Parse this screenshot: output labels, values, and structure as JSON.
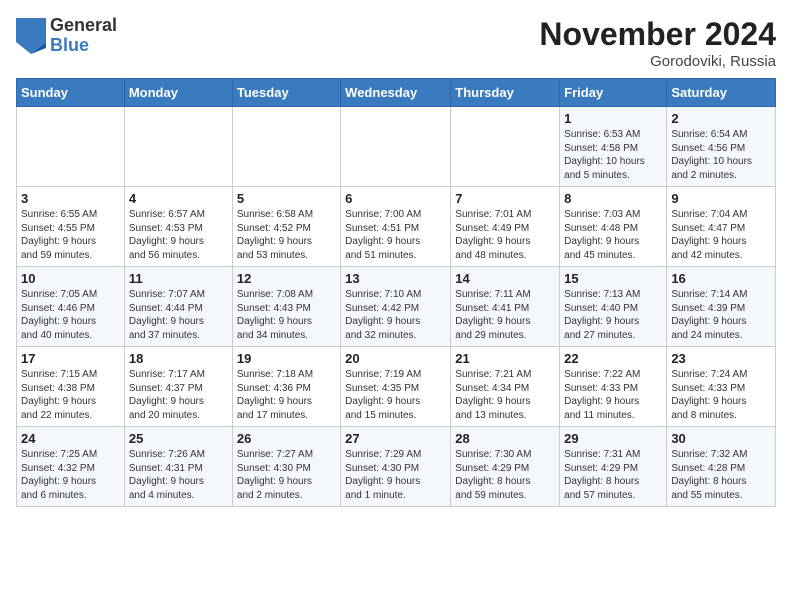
{
  "header": {
    "logo_general": "General",
    "logo_blue": "Blue",
    "month_title": "November 2024",
    "location": "Gorodoviki, Russia"
  },
  "columns": [
    "Sunday",
    "Monday",
    "Tuesday",
    "Wednesday",
    "Thursday",
    "Friday",
    "Saturday"
  ],
  "weeks": [
    [
      {
        "day": "",
        "info": ""
      },
      {
        "day": "",
        "info": ""
      },
      {
        "day": "",
        "info": ""
      },
      {
        "day": "",
        "info": ""
      },
      {
        "day": "",
        "info": ""
      },
      {
        "day": "1",
        "info": "Sunrise: 6:53 AM\nSunset: 4:58 PM\nDaylight: 10 hours\nand 5 minutes."
      },
      {
        "day": "2",
        "info": "Sunrise: 6:54 AM\nSunset: 4:56 PM\nDaylight: 10 hours\nand 2 minutes."
      }
    ],
    [
      {
        "day": "3",
        "info": "Sunrise: 6:55 AM\nSunset: 4:55 PM\nDaylight: 9 hours\nand 59 minutes."
      },
      {
        "day": "4",
        "info": "Sunrise: 6:57 AM\nSunset: 4:53 PM\nDaylight: 9 hours\nand 56 minutes."
      },
      {
        "day": "5",
        "info": "Sunrise: 6:58 AM\nSunset: 4:52 PM\nDaylight: 9 hours\nand 53 minutes."
      },
      {
        "day": "6",
        "info": "Sunrise: 7:00 AM\nSunset: 4:51 PM\nDaylight: 9 hours\nand 51 minutes."
      },
      {
        "day": "7",
        "info": "Sunrise: 7:01 AM\nSunset: 4:49 PM\nDaylight: 9 hours\nand 48 minutes."
      },
      {
        "day": "8",
        "info": "Sunrise: 7:03 AM\nSunset: 4:48 PM\nDaylight: 9 hours\nand 45 minutes."
      },
      {
        "day": "9",
        "info": "Sunrise: 7:04 AM\nSunset: 4:47 PM\nDaylight: 9 hours\nand 42 minutes."
      }
    ],
    [
      {
        "day": "10",
        "info": "Sunrise: 7:05 AM\nSunset: 4:46 PM\nDaylight: 9 hours\nand 40 minutes."
      },
      {
        "day": "11",
        "info": "Sunrise: 7:07 AM\nSunset: 4:44 PM\nDaylight: 9 hours\nand 37 minutes."
      },
      {
        "day": "12",
        "info": "Sunrise: 7:08 AM\nSunset: 4:43 PM\nDaylight: 9 hours\nand 34 minutes."
      },
      {
        "day": "13",
        "info": "Sunrise: 7:10 AM\nSunset: 4:42 PM\nDaylight: 9 hours\nand 32 minutes."
      },
      {
        "day": "14",
        "info": "Sunrise: 7:11 AM\nSunset: 4:41 PM\nDaylight: 9 hours\nand 29 minutes."
      },
      {
        "day": "15",
        "info": "Sunrise: 7:13 AM\nSunset: 4:40 PM\nDaylight: 9 hours\nand 27 minutes."
      },
      {
        "day": "16",
        "info": "Sunrise: 7:14 AM\nSunset: 4:39 PM\nDaylight: 9 hours\nand 24 minutes."
      }
    ],
    [
      {
        "day": "17",
        "info": "Sunrise: 7:15 AM\nSunset: 4:38 PM\nDaylight: 9 hours\nand 22 minutes."
      },
      {
        "day": "18",
        "info": "Sunrise: 7:17 AM\nSunset: 4:37 PM\nDaylight: 9 hours\nand 20 minutes."
      },
      {
        "day": "19",
        "info": "Sunrise: 7:18 AM\nSunset: 4:36 PM\nDaylight: 9 hours\nand 17 minutes."
      },
      {
        "day": "20",
        "info": "Sunrise: 7:19 AM\nSunset: 4:35 PM\nDaylight: 9 hours\nand 15 minutes."
      },
      {
        "day": "21",
        "info": "Sunrise: 7:21 AM\nSunset: 4:34 PM\nDaylight: 9 hours\nand 13 minutes."
      },
      {
        "day": "22",
        "info": "Sunrise: 7:22 AM\nSunset: 4:33 PM\nDaylight: 9 hours\nand 11 minutes."
      },
      {
        "day": "23",
        "info": "Sunrise: 7:24 AM\nSunset: 4:33 PM\nDaylight: 9 hours\nand 8 minutes."
      }
    ],
    [
      {
        "day": "24",
        "info": "Sunrise: 7:25 AM\nSunset: 4:32 PM\nDaylight: 9 hours\nand 6 minutes."
      },
      {
        "day": "25",
        "info": "Sunrise: 7:26 AM\nSunset: 4:31 PM\nDaylight: 9 hours\nand 4 minutes."
      },
      {
        "day": "26",
        "info": "Sunrise: 7:27 AM\nSunset: 4:30 PM\nDaylight: 9 hours\nand 2 minutes."
      },
      {
        "day": "27",
        "info": "Sunrise: 7:29 AM\nSunset: 4:30 PM\nDaylight: 9 hours\nand 1 minute."
      },
      {
        "day": "28",
        "info": "Sunrise: 7:30 AM\nSunset: 4:29 PM\nDaylight: 8 hours\nand 59 minutes."
      },
      {
        "day": "29",
        "info": "Sunrise: 7:31 AM\nSunset: 4:29 PM\nDaylight: 8 hours\nand 57 minutes."
      },
      {
        "day": "30",
        "info": "Sunrise: 7:32 AM\nSunset: 4:28 PM\nDaylight: 8 hours\nand 55 minutes."
      }
    ]
  ]
}
